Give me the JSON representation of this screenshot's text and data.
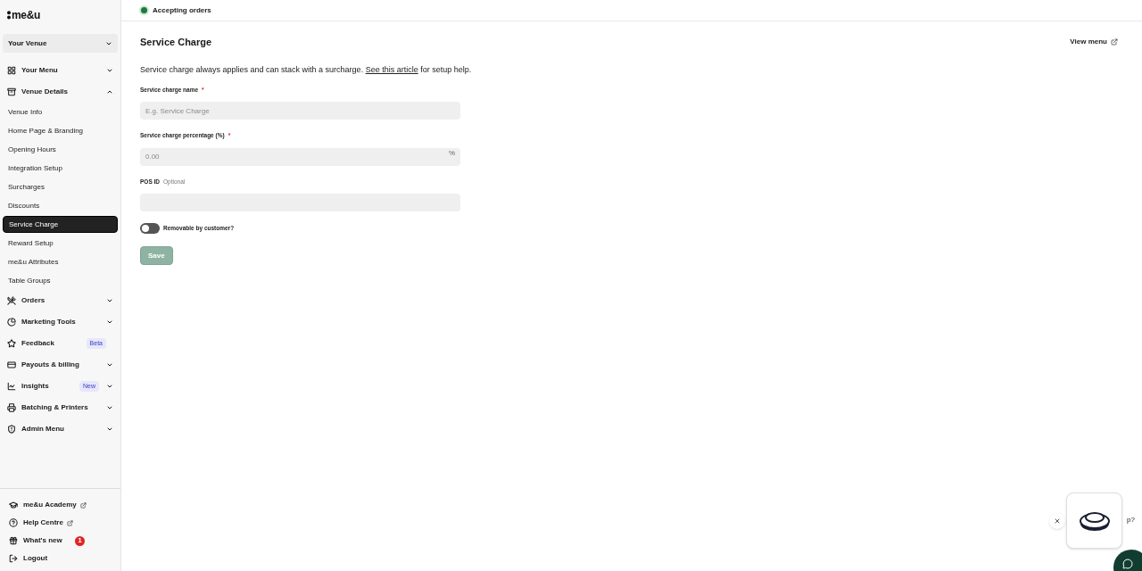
{
  "logo": "me&u",
  "venue_selector": {
    "label": "Your Venue"
  },
  "nav": [
    {
      "kind": "group",
      "label": "Your Menu",
      "expanded": false
    },
    {
      "kind": "group",
      "label": "Venue Details",
      "expanded": true,
      "children": [
        {
          "label": "Venue Info",
          "selected": false
        },
        {
          "label": "Home Page & Branding",
          "selected": false
        },
        {
          "label": "Opening Hours",
          "selected": false
        },
        {
          "label": "Integration Setup",
          "selected": false
        },
        {
          "label": "Surcharges",
          "selected": false
        },
        {
          "label": "Discounts",
          "selected": false
        },
        {
          "label": "Service Charge",
          "selected": true
        },
        {
          "label": "Reward Setup",
          "selected": false
        },
        {
          "label": "me&u Attributes",
          "selected": false
        },
        {
          "label": "Table Groups",
          "selected": false
        }
      ]
    },
    {
      "kind": "group",
      "label": "Orders",
      "expanded": false
    },
    {
      "kind": "group",
      "label": "Marketing Tools",
      "expanded": false
    },
    {
      "kind": "link",
      "label": "Feedback",
      "badge": "Beta"
    },
    {
      "kind": "group",
      "label": "Payouts & billing",
      "expanded": false
    },
    {
      "kind": "group",
      "label": "Insights",
      "expanded": false,
      "badge": "New"
    },
    {
      "kind": "group",
      "label": "Batching & Printers",
      "expanded": false
    },
    {
      "kind": "group",
      "label": "Admin Menu",
      "expanded": false
    }
  ],
  "footer_links": [
    {
      "label": "me&u Academy",
      "external": true
    },
    {
      "label": "Help Centre",
      "external": true
    },
    {
      "label": "What's new",
      "external": false,
      "count": "1"
    },
    {
      "label": "Logout",
      "external": false
    }
  ],
  "status": {
    "label": "Accepting orders",
    "color": "#1e7a3c"
  },
  "page": {
    "title": "Service Charge",
    "view_menu": "View menu",
    "description_before": "Service charge always applies and can stack with a surcharge. ",
    "description_link": "See this article",
    "description_after": " for setup help.",
    "fields": [
      {
        "label": "Service charge name",
        "required_mark": "*",
        "placeholder": "E.g. Service Charge"
      },
      {
        "label": "Service charge percentage (%)",
        "required_mark": "*",
        "placeholder": "0.00",
        "suffix": "%"
      },
      {
        "label": "POS ID",
        "hint": "Optional"
      }
    ],
    "toggle": {
      "label": "Removable by customer?",
      "on": false
    },
    "save": {
      "label": "Save",
      "disabled": true
    }
  },
  "chat": {
    "peek_text": "p?"
  }
}
